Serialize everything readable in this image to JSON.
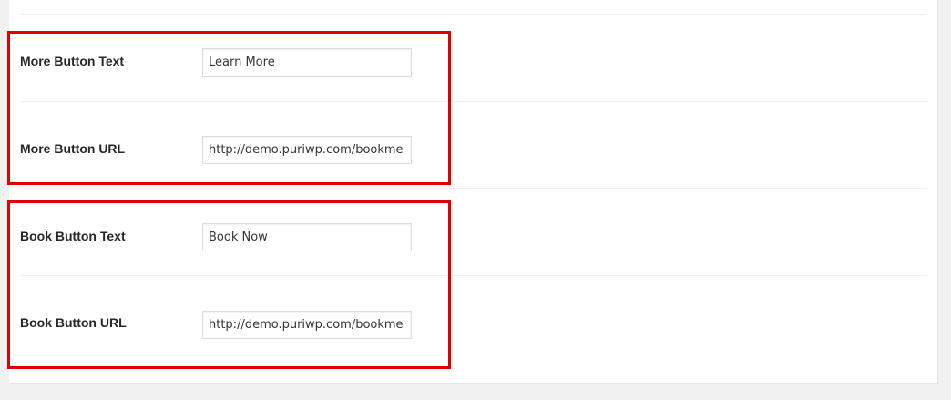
{
  "fields": {
    "more_button_text": {
      "label": "More Button Text",
      "value": "Learn More"
    },
    "more_button_url": {
      "label": "More Button URL",
      "value": "http://demo.puriwp.com/bookme"
    },
    "book_button_text": {
      "label": "Book Button Text",
      "value": "Book Now"
    },
    "book_button_url": {
      "label": "Book Button URL",
      "value": "http://demo.puriwp.com/bookme"
    }
  },
  "colors": {
    "highlight": "#e00000",
    "panel_background": "#ffffff",
    "page_background": "#f1f1f1",
    "label_text": "#23282d",
    "field_border": "#dddddd"
  }
}
